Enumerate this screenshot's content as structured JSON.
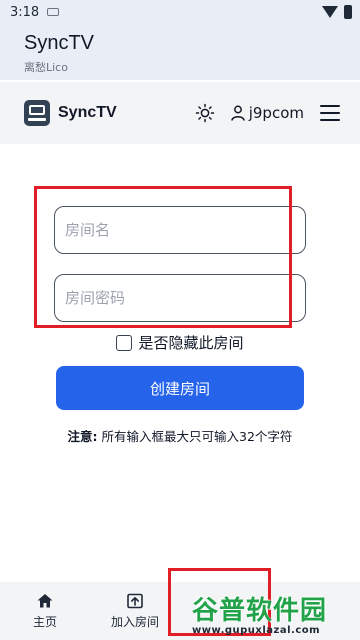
{
  "status_bar": {
    "time": "3:18"
  },
  "app_bar": {
    "title": "SyncTV",
    "subtitle": "离愁Lico"
  },
  "nav": {
    "brand": "SyncTV",
    "username": "j9pcom"
  },
  "form": {
    "room_name_placeholder": "房间名",
    "room_password_placeholder": "房间密码",
    "hide_room_label": "是否隐藏此房间",
    "create_button_label": "创建房间",
    "notice_label": "注意:",
    "notice_text": " 所有输入框最大只可输入32个字符"
  },
  "bottom_nav": {
    "tabs": [
      {
        "label": "主页",
        "icon": "home-icon"
      },
      {
        "label": "加入房间",
        "icon": "join-room-icon"
      }
    ]
  },
  "watermark": {
    "text": "谷普软件园",
    "url": "www.gupuxlazal.com"
  },
  "colors": {
    "primary": "#2563eb",
    "annotation": "#e11d25",
    "watermark": "#22a34a"
  }
}
